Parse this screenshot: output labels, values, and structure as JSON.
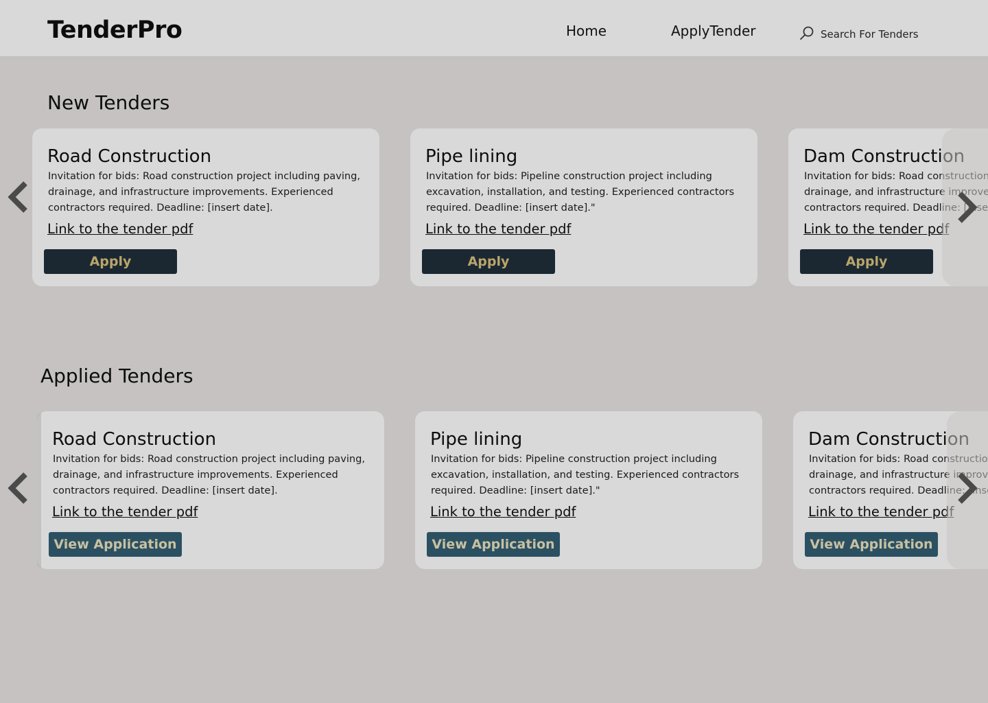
{
  "header": {
    "brand": "TenderPro",
    "nav": {
      "home": "Home",
      "apply_tender": "ApplyTender"
    },
    "search": {
      "placeholder": "Search For Tenders"
    }
  },
  "new_tenders": {
    "title": "New Tenders",
    "cards": [
      {
        "title": "Road Construction",
        "description": "Invitation for bids: Road construction project including paving, drainage, and infrastructure improvements. Experienced contractors required. Deadline: [insert date].",
        "link": "Link to the tender pdf",
        "button": "Apply"
      },
      {
        "title": "Pipe lining",
        "description": "Invitation for bids: Pipeline construction project including excavation, installation, and testing. Experienced contractors required. Deadline: [insert date].\"",
        "link": "Link to the tender pdf",
        "button": "Apply"
      },
      {
        "title": "Dam Construction",
        "description": "Invitation for bids: Road construction project including paving, drainage, and infrastructure improvements. Experienced contractors required. Deadline: [insert date].",
        "link": "Link to the tender pdf",
        "button": "Apply"
      }
    ]
  },
  "applied_tenders": {
    "title": "Applied Tenders",
    "cards": [
      {
        "title": "Road Construction",
        "description": "Invitation for bids: Road construction project including paving, drainage, and infrastructure improvements. Experienced contractors required. Deadline: [insert date].",
        "link": "Link to the tender pdf",
        "button": "View Application"
      },
      {
        "title": "Pipe lining",
        "description": "Invitation for bids: Pipeline construction project including excavation, installation, and testing. Experienced contractors required. Deadline: [insert date].\"",
        "link": "Link to the tender pdf",
        "button": "View Application"
      },
      {
        "title": "Dam Construction",
        "description": "Invitation for bids: Road construction project including paving, drainage, and infrastructure improvements. Experienced contractors required. Deadline: [insert date].",
        "link": "Link to the tender pdf",
        "button": "View Application"
      }
    ]
  },
  "icons": {
    "search": "search-icon",
    "prev": "chevron-left-icon",
    "next": "chevron-right-icon"
  },
  "colors": {
    "page_bg": "#c5c2c1",
    "header_bg": "#d9d9d9",
    "card_bg": "#d9d9d9",
    "apply_button_bg": "#1b2832",
    "apply_button_text": "#b9a56b",
    "view_button_bg": "#2b5062",
    "view_button_text": "#c8c1a2"
  }
}
